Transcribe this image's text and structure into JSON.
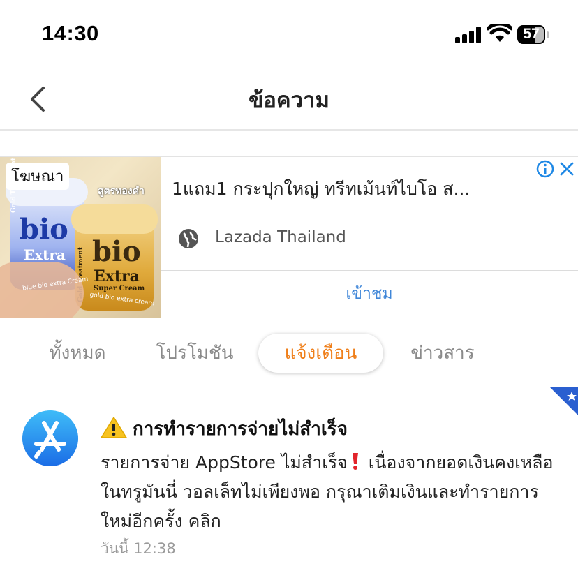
{
  "status_bar": {
    "time": "14:30",
    "battery": "57"
  },
  "header": {
    "title": "ข้อความ"
  },
  "ad": {
    "label": "โฆษณา",
    "title": "1แถม1 กระปุกใหญ่ ทรีทเม้นท์ไบโอ ส...",
    "source": "Lazada Thailand",
    "cta": "เข้าชม",
    "image_text": {
      "badge_top": "สูตรทองคำ",
      "jar_blue_brand": "bio",
      "jar_blue_line": "Extra",
      "jar_gold_brand": "bio",
      "jar_gold_line": "Extra",
      "jar_gold_sub": "Super Cream",
      "jar_gold_side": "Gold Treatment",
      "jar_blue_side": "Gold Treatment",
      "caption_blue": "blue bio extra Cream",
      "caption_gold": "gold bio extra cream"
    }
  },
  "tabs": [
    {
      "label": "ทั้งหมด",
      "active": false
    },
    {
      "label": "โปรโมชัน",
      "active": false
    },
    {
      "label": "แจ้งเตือน",
      "active": true
    },
    {
      "label": "ข่าวสาร",
      "active": false
    }
  ],
  "notification": {
    "icon": "app-store-icon",
    "title": "การทำรายการจ่ายไม่สำเร็จ",
    "body_part1": "รายการจ่าย AppStore ไม่สำเร็จ",
    "body_part2": "เนื่องจากยอดเงินคงเหลือในทรูมันนี่ วอลเล็ทไม่เพียงพอ กรุณาเติมเงินและทำรายการใหม่อีกครั้ง คลิก",
    "time": "วันนี้ 12:38"
  },
  "colors": {
    "accent_orange": "#ef7f1a",
    "link_blue": "#3f86d8",
    "app_icon_blue": "#1a6fe8"
  }
}
